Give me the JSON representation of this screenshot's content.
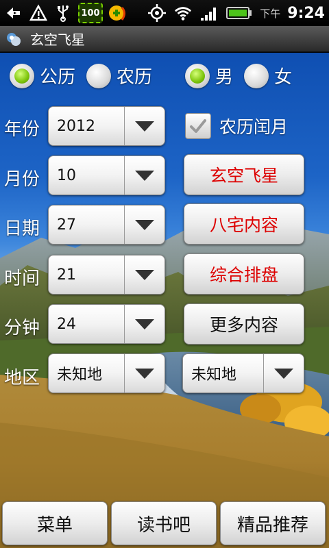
{
  "status_bar": {
    "icons_left": [
      "back-usb-icon",
      "warning-icon",
      "usb-icon",
      "battery-100-badge",
      "app-notification-icon"
    ],
    "battery_badge_text": "100",
    "icons_right": [
      "gps-icon",
      "wifi-icon",
      "signal-icon",
      "battery-icon"
    ],
    "time_period": "下午",
    "time": "9:24"
  },
  "title_bar": {
    "title": "玄空飞星"
  },
  "calendar_type": {
    "options": [
      {
        "label": "公历",
        "selected": true
      },
      {
        "label": "农历",
        "selected": false
      }
    ]
  },
  "gender": {
    "options": [
      {
        "label": "男",
        "selected": true
      },
      {
        "label": "女",
        "selected": false
      }
    ]
  },
  "fields": [
    {
      "label": "年份",
      "value": "2012"
    },
    {
      "label": "月份",
      "value": "10"
    },
    {
      "label": "日期",
      "value": "27"
    },
    {
      "label": "时间",
      "value": "21"
    },
    {
      "label": "分钟",
      "value": "24"
    },
    {
      "label": "地区",
      "value": "未知地"
    }
  ],
  "region2": {
    "value": "未知地"
  },
  "leap_month": {
    "label": "农历闰月",
    "checked": true
  },
  "actions": [
    {
      "label": "玄空飞星",
      "color": "#dd0000"
    },
    {
      "label": "八宅内容",
      "color": "#dd0000"
    },
    {
      "label": "综合排盘",
      "color": "#dd0000"
    },
    {
      "label": "更多内容",
      "color": "#111111"
    }
  ],
  "bottom_bar": [
    {
      "label": "菜单"
    },
    {
      "label": "读书吧"
    },
    {
      "label": "精品推荐"
    }
  ]
}
